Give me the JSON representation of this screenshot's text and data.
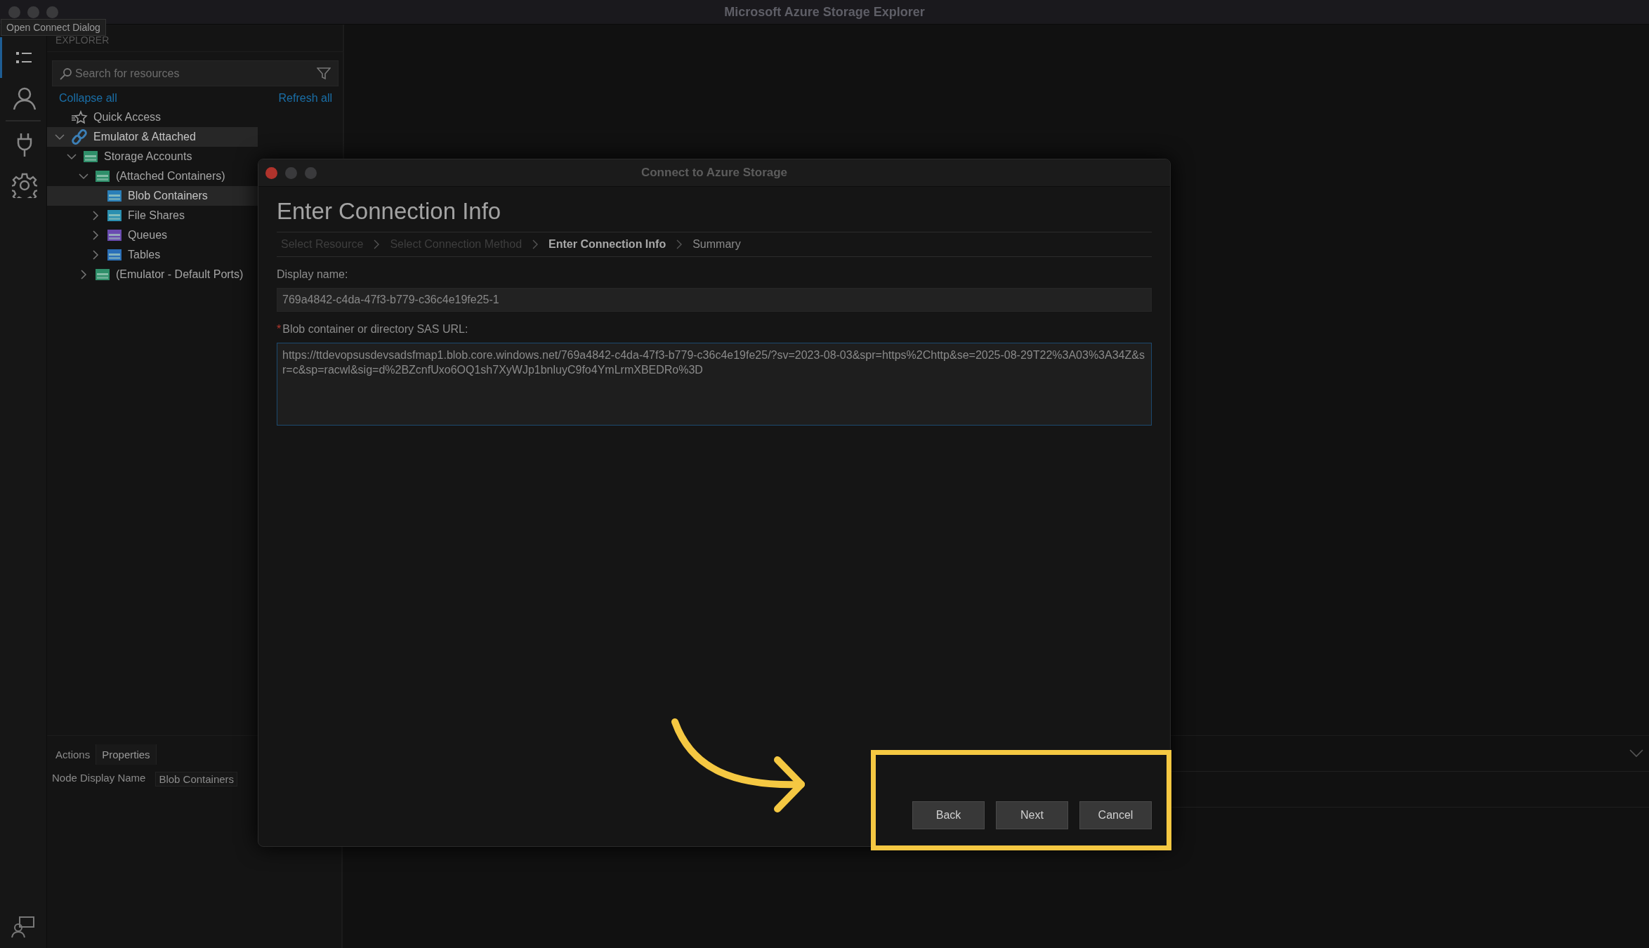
{
  "window": {
    "title": "Microsoft Azure Storage Explorer"
  },
  "tooltip": "Open Connect Dialog",
  "activity_bar": [
    {
      "kind": "explorer",
      "selected": true
    },
    {
      "kind": "account",
      "selected": false
    },
    {
      "kind": "connect",
      "selected": false
    },
    {
      "kind": "settings",
      "selected": false
    }
  ],
  "explorer": {
    "title": "EXPLORER",
    "search": {
      "placeholder": "Search for resources"
    },
    "collapse_link": "Collapse all",
    "refresh_link": "Refresh all",
    "tree": [
      {
        "label": "Quick Access",
        "kind": "quick",
        "selected": false
      },
      {
        "label": "Emulator & Attached",
        "kind": "link",
        "expanded": true,
        "selected": true,
        "children": [
          {
            "label": "Storage Accounts",
            "kind": "storage",
            "expanded": true,
            "selected": false,
            "children": [
              {
                "label": "(Attached Containers)",
                "kind": "storage",
                "expanded": true,
                "selected": false,
                "children": [
                  {
                    "label": "Blob Containers",
                    "kind": "blob",
                    "selected": true
                  },
                  {
                    "label": "File Shares",
                    "kind": "file",
                    "expanded": false,
                    "selected": false
                  },
                  {
                    "label": "Queues",
                    "kind": "queue",
                    "expanded": false,
                    "selected": false
                  },
                  {
                    "label": "Tables",
                    "kind": "table",
                    "expanded": false,
                    "selected": false
                  }
                ]
              },
              {
                "label": "(Emulator - Default Ports)",
                "kind": "storage",
                "expanded": false,
                "selected": false
              }
            ]
          }
        ]
      }
    ]
  },
  "bottom_panel": {
    "tabs": [
      {
        "label": "Actions",
        "selected": false
      },
      {
        "label": "Properties",
        "selected": true
      }
    ],
    "properties": [
      {
        "name": "Node Display Name",
        "value": "Blob Containers"
      }
    ]
  },
  "dialog": {
    "title": "Connect to Azure Storage",
    "heading": "Enter Connection Info",
    "steps": [
      {
        "label": "Select Resource",
        "selected": false,
        "disabled": true
      },
      {
        "label": "Select Connection Method",
        "selected": false,
        "disabled": true
      },
      {
        "label": "Enter Connection Info",
        "selected": true,
        "disabled": false
      },
      {
        "label": "Summary",
        "selected": false,
        "disabled": false
      }
    ],
    "fields": [
      {
        "kind": "input",
        "label": "Display name:",
        "value": "769a4842-c4da-47f3-b779-c36c4e19fe25-1"
      },
      {
        "kind": "textarea",
        "required_mark": "*",
        "label": "Blob container or directory SAS URL:",
        "value": "https://ttdevopsusdevsadsfmap1.blob.core.windows.net/769a4842-c4da-47f3-b779-c36c4e19fe25/?sv=2023-08-03&spr=https%2Chttp&se=2025-08-29T22%3A03%3A34Z&sr=c&sp=racwl&sig=d%2BZcnfUxo6OQ1sh7XyWJp1bnluyC9fo4YmLrmXBEDRo%3D"
      }
    ],
    "buttons": [
      "Back",
      "Next",
      "Cancel"
    ]
  }
}
